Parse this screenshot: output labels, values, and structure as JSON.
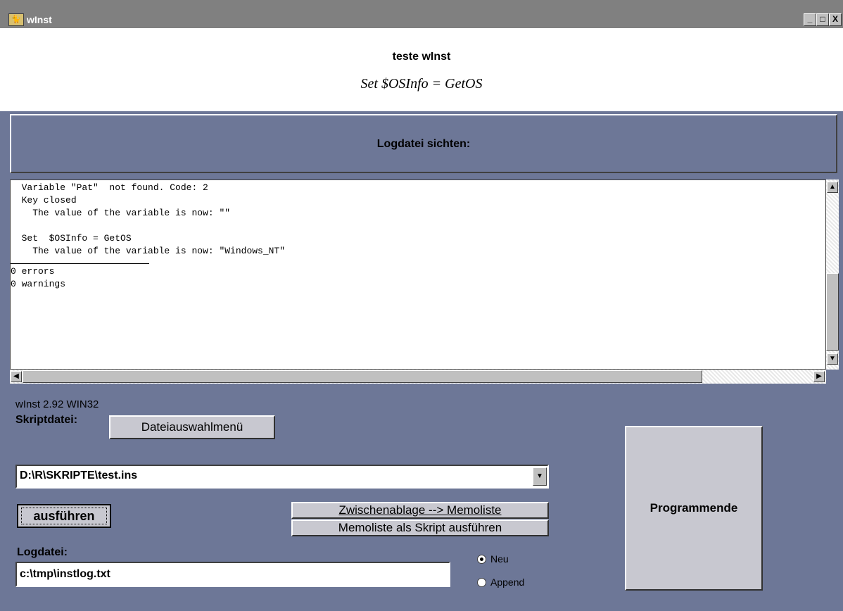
{
  "window": {
    "title": "wInst",
    "controls": {
      "minimize": "_",
      "maximize": "□",
      "close": "X"
    }
  },
  "header": {
    "title": "teste wInst",
    "subtitle": "Set  $OSInfo = GetOS"
  },
  "banner": {
    "text": "Logdatei sichten:"
  },
  "log": {
    "lines": [
      "  Variable \"Pat\"  not found. Code: 2",
      "  Key closed",
      "    The value of the variable is now: \"\"",
      "",
      "  Set  $OSInfo = GetOS",
      "    The value of the variable is now: \"Windows_NT\"",
      ""
    ],
    "summary": [
      "0 errors",
      "0 warnings"
    ]
  },
  "footer": {
    "version": "wInst 2.92 WIN32",
    "skript_label": "Skriptdatei:",
    "file_menu_button": "Dateiauswahlmenü",
    "script_path": "D:\\R\\SKRIPTE\\test.ins",
    "run_button": "ausführen",
    "clipboard_button": "Zwischenablage --> Memoliste",
    "memo_run_button": "Memoliste als Skript ausführen",
    "quit_button": "Programmende",
    "logfile_label": "Logdatei:",
    "logfile_value": "c:\\tmp\\instlog.txt",
    "radio_new": "Neu",
    "radio_append": "Append",
    "radio_selected": "Neu"
  },
  "colors": {
    "background": "#6d7797",
    "titlebar": "#808080",
    "button_face": "#c8c8d0"
  }
}
